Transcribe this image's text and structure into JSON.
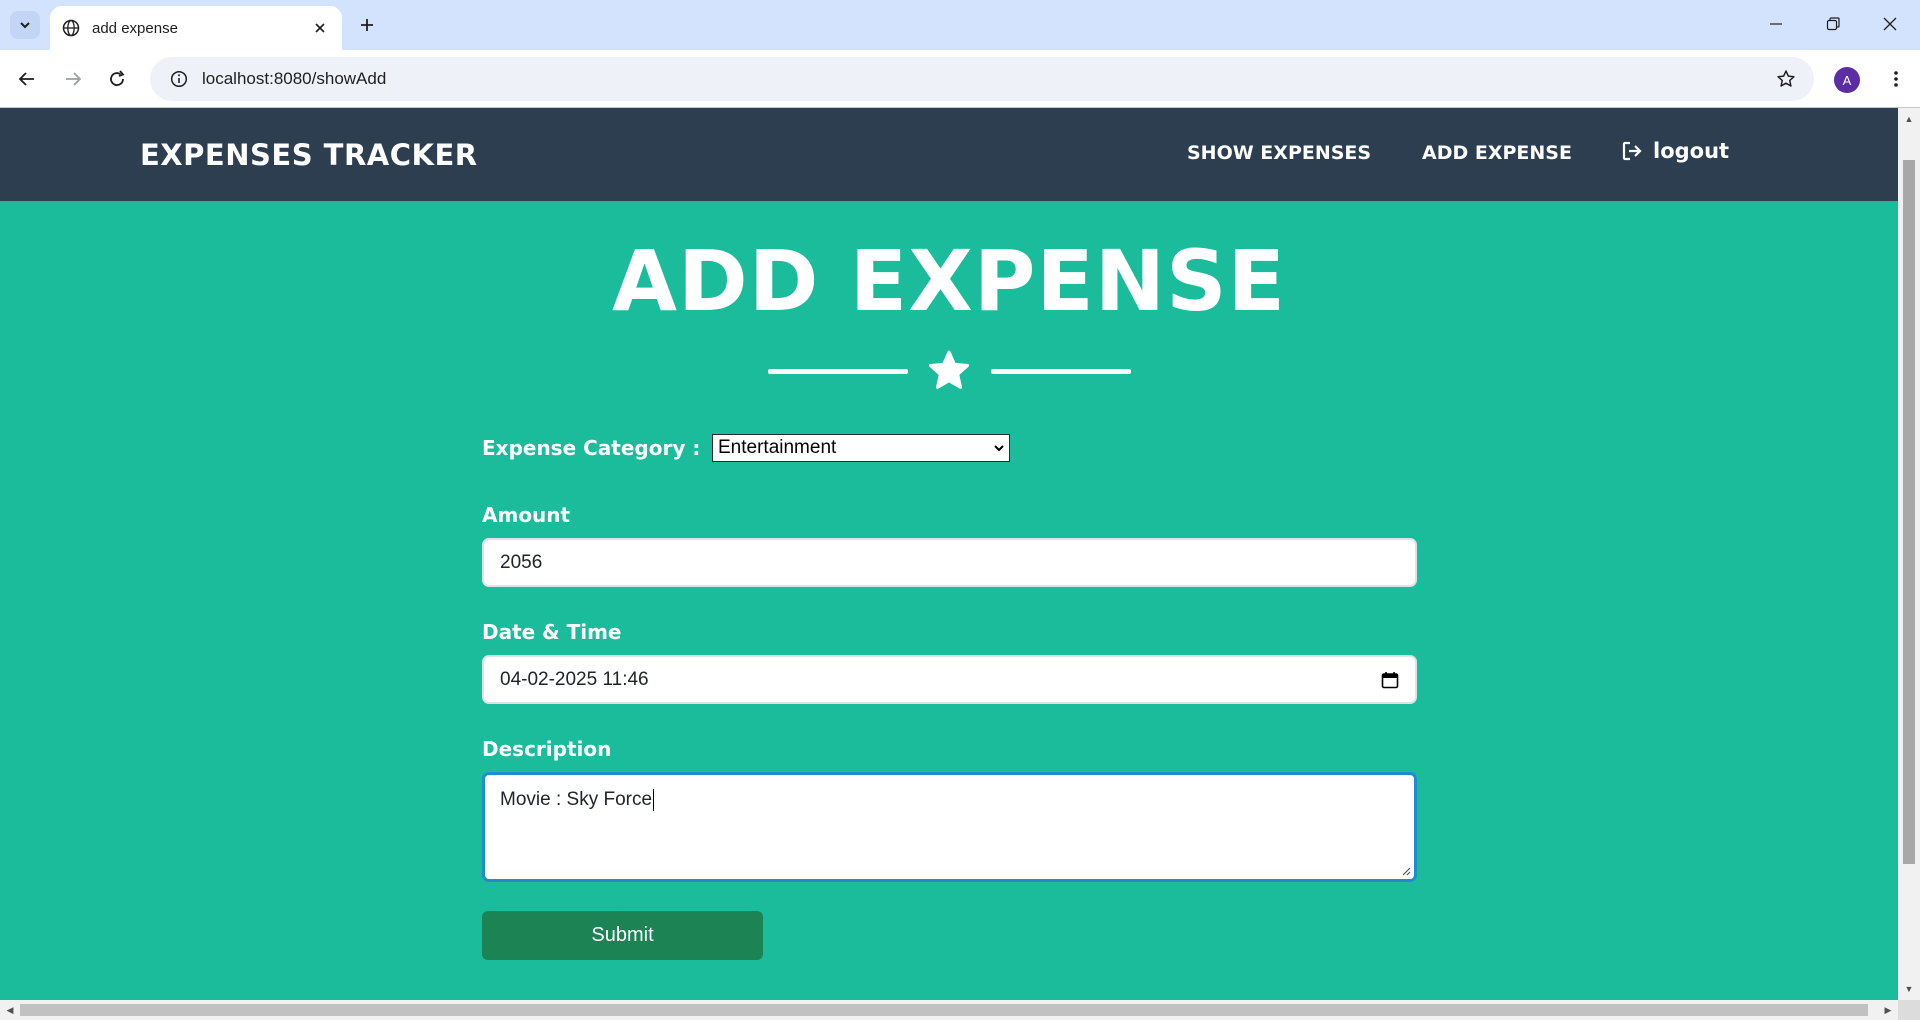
{
  "browser": {
    "tab_title": "add expense",
    "url": "localhost:8080/showAdd",
    "profile_initial": "A"
  },
  "navbar": {
    "brand": "EXPENSES TRACKER",
    "links": [
      "SHOW EXPENSES",
      "ADD EXPENSE"
    ],
    "logout": "logout"
  },
  "page": {
    "title": "ADD EXPENSE"
  },
  "form": {
    "category_label": "Expense Category :",
    "category_value": "Entertainment",
    "amount_label": "Amount",
    "amount_value": "2056",
    "datetime_label": "Date & Time",
    "datetime_value": "04-02-2025 11:46",
    "description_label": "Description",
    "description_value": "Movie : Sky Force",
    "submit_label": "Submit"
  },
  "colors": {
    "page_bg": "#1abc9c",
    "navbar_bg": "#2c3e50",
    "submit_bg": "#1b8354",
    "focus_border": "#1f8cd0"
  }
}
